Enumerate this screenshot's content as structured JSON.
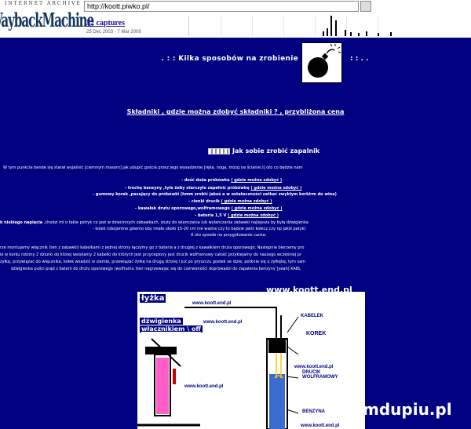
{
  "toolbar": {
    "archive_label": "INTERNET ARCHIVE",
    "logo": "WaybackMachine",
    "url": "http://koott.piwko.pl/",
    "captures": "32 captures",
    "date_range": "25 Dec 2003 - 7 Mar 2009"
  },
  "page": {
    "title": ". : : Kilka sposobów na zrobienie",
    "title_suffix": ": : . .",
    "nav": "Składniki , gdzie można zdobyć składniki ? , przybliżona cena",
    "section_title": "Jak sobie zrobić zapalnik",
    "intro": "W tym punkcie bende się starał wyjaśnić [ciemnym masom] jak udupić gościa przez jego wysadzenie [ręka, noga, mózg na ścianie:)] oto co będzie nam",
    "ingredients": [
      {
        "text": "- dość duża próbówka",
        "link": "( gdzie można zdobyć )"
      },
      {
        "text": "- trochę benzyny ,tyle żeby starczyło zapełnić próbówkę",
        "link": "( gdzie można zdobyć )"
      },
      {
        "text": "- gumowy korek ,pasujący do próbówki (hmm zrobić jakoś a w ostateczności zatkać zwykłym korkirm do wina)",
        "link": ""
      },
      {
        "text": "- cienki drucik",
        "link": "( gdzie można zdobyć )"
      },
      {
        "text": "- kawałek drutu oporowego,wolframowego",
        "link": "( gdzie można zdobyć )"
      },
      {
        "text": "- bateria 1,5 V",
        "link": "( gdzie można zdobyć )"
      }
    ],
    "switch_note_label": "k niskiego napięcia",
    "switch_note": ",chodzi mi o takie pstryk co jest w dziecinnych zabawkach, służy do wlanczania lub wyłanczania zabawki najlepsza by była dźwigienka",
    "cork_line": "- kolek (obojentne gówmo oby miało około 15-20 cm nie ważne czy to będzie jakiś kołecz czy np jakiś patyk)",
    "prep_line": "A oto sposób na przygotowanie cacka:",
    "paragraph": [
      "rze montujemy włącznik (ten z zabawki) kabelkami z jednej strony łączymy go z bateria a z drugiej z kawałkiem druta oporowego. Następnie bierzemy pro",
      "ie w korku robimy 2 dziurki do której wsiskamy 2 kabelki do których jest przycepiony jest drucik wolframowy całość przyklejamy do naszego wcześniej pr",
      "zyłkę, przywiązać do włącznika, kołek wsadzić w ziemie, przewiązać żyłkę na drugą stronę i już po pryszczu gostek se idzie, potknie się o żyłkękę, tym sam",
      "dźwigienka puści prąd z baterii do drutu oporowego (wolframu )ten nagrzewając się do czerwoności doprowadzi do zapalenia benzyny [yeah] KABL"
    ],
    "site_caption": "www.koott.end.pl"
  },
  "diagram": {
    "tags": [
      "łyżka",
      "dźwigienka",
      "włacznikiem \\ off"
    ],
    "labels": [
      "KABELEK",
      "KOREK",
      "DRUCIK WOLFRAMOWY",
      "BENZYNA"
    ],
    "small_caption": "www.koott.end.pl"
  },
  "watermark": "mdupiu.pl",
  "colors": {
    "background": "#000080",
    "text": "#ffffff",
    "link": "#ffffff"
  }
}
